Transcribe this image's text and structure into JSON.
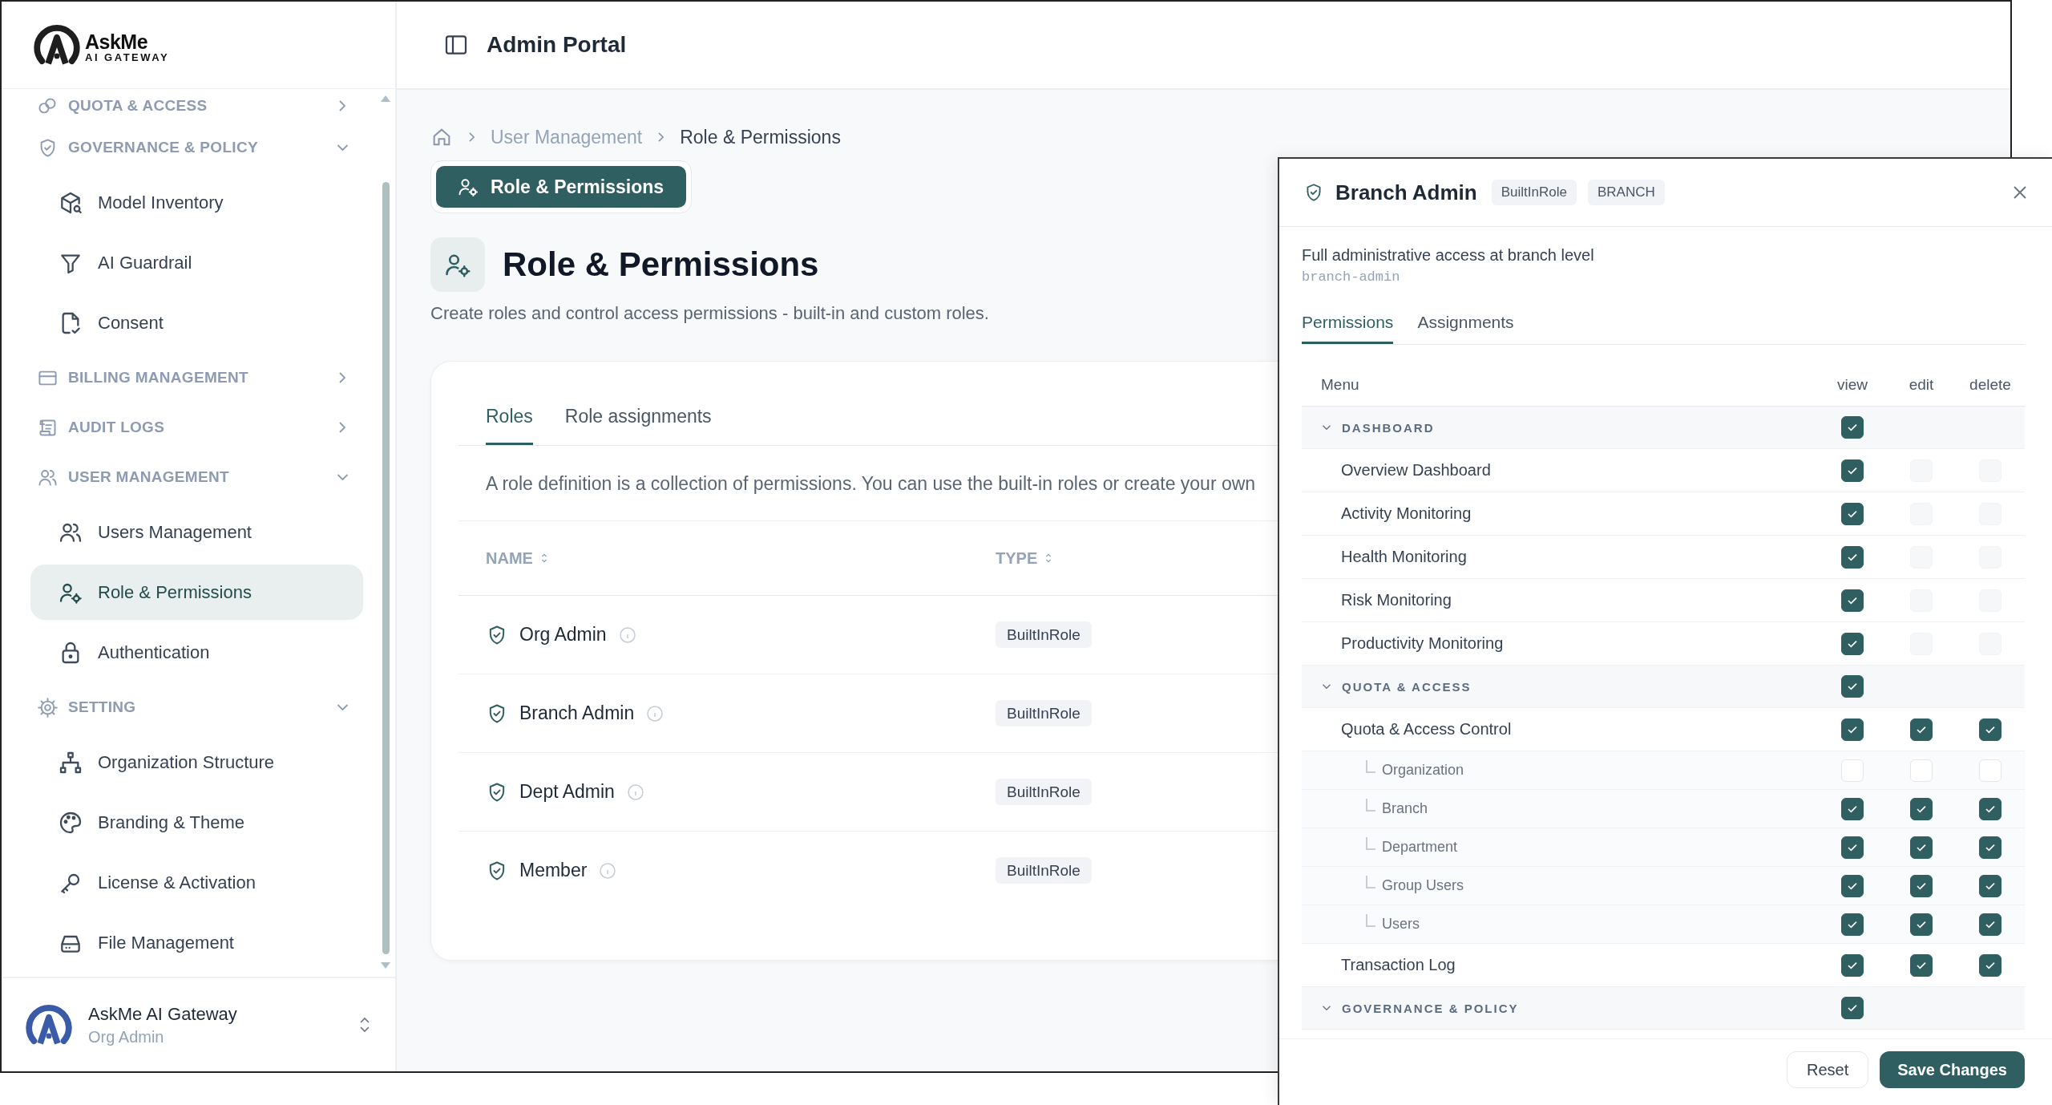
{
  "logo": {
    "name": "AskMe",
    "tagline": "AI GATEWAY"
  },
  "sidebar": {
    "groups": [
      {
        "label": "QUOTA & ACCESS",
        "expanded": false
      },
      {
        "label": "GOVERNANCE & POLICY",
        "expanded": true,
        "items": [
          {
            "label": "Model Inventory",
            "selected": false
          },
          {
            "label": "AI Guardrail",
            "selected": false
          },
          {
            "label": "Consent",
            "selected": false
          }
        ]
      },
      {
        "label": "BILLING MANAGEMENT",
        "expanded": false
      },
      {
        "label": "AUDIT LOGS",
        "expanded": false
      },
      {
        "label": "USER MANAGEMENT",
        "expanded": true,
        "items": [
          {
            "label": "Users Management",
            "selected": false
          },
          {
            "label": "Role & Permissions",
            "selected": true
          },
          {
            "label": "Authentication",
            "selected": false
          }
        ]
      },
      {
        "label": "SETTING",
        "expanded": true,
        "items": [
          {
            "label": "Organization Structure",
            "selected": false
          },
          {
            "label": "Branding & Theme",
            "selected": false
          },
          {
            "label": "License & Activation",
            "selected": false
          },
          {
            "label": "File Management",
            "selected": false
          }
        ]
      }
    ],
    "footer": {
      "name": "AskMe AI Gateway",
      "role": "Org Admin"
    }
  },
  "header": {
    "title": "Admin Portal"
  },
  "breadcrumb": [
    "User Management",
    "Role & Permissions"
  ],
  "page_button": "Role & Permissions",
  "page": {
    "title": "Role & Permissions",
    "subtitle": "Create roles and control access permissions - built-in and custom roles."
  },
  "tabs": [
    {
      "label": "Roles",
      "selected": true
    },
    {
      "label": "Role assignments",
      "selected": false
    }
  ],
  "roles_note": "A role definition is a collection of permissions. You can use the built-in roles or create your own",
  "table": {
    "columns": [
      "NAME",
      "TYPE"
    ],
    "rows": [
      {
        "name": "Org Admin",
        "type": "BuiltInRole"
      },
      {
        "name": "Branch Admin",
        "type": "BuiltInRole"
      },
      {
        "name": "Dept Admin",
        "type": "BuiltInRole"
      },
      {
        "name": "Member",
        "type": "BuiltInRole"
      }
    ]
  },
  "drawer": {
    "title": "Branch Admin",
    "badges": [
      "BuiltInRole",
      "BRANCH"
    ],
    "description": "Full administrative access at branch level",
    "code": "branch-admin",
    "tabs": [
      {
        "label": "Permissions",
        "selected": true
      },
      {
        "label": "Assignments",
        "selected": false
      }
    ],
    "columns": [
      "Menu",
      "view",
      "edit",
      "delete"
    ],
    "permissions": [
      {
        "label": "DASHBOARD",
        "expanded": true,
        "view": {
          "checked": true,
          "disabled": false
        },
        "children": [
          {
            "label": "Overview Dashboard",
            "view": {
              "checked": true,
              "disabled": false
            },
            "edit": {
              "checked": false,
              "disabled": true
            },
            "delete": {
              "checked": false,
              "disabled": true
            }
          },
          {
            "label": "Activity Monitoring",
            "view": {
              "checked": true,
              "disabled": false
            },
            "edit": {
              "checked": false,
              "disabled": true
            },
            "delete": {
              "checked": false,
              "disabled": true
            }
          },
          {
            "label": "Health Monitoring",
            "view": {
              "checked": true,
              "disabled": false
            },
            "edit": {
              "checked": false,
              "disabled": true
            },
            "delete": {
              "checked": false,
              "disabled": true
            }
          },
          {
            "label": "Risk Monitoring",
            "view": {
              "checked": true,
              "disabled": false
            },
            "edit": {
              "checked": false,
              "disabled": true
            },
            "delete": {
              "checked": false,
              "disabled": true
            }
          },
          {
            "label": "Productivity Monitoring",
            "view": {
              "checked": true,
              "disabled": false
            },
            "edit": {
              "checked": false,
              "disabled": true
            },
            "delete": {
              "checked": false,
              "disabled": true
            }
          }
        ]
      },
      {
        "label": "QUOTA & ACCESS",
        "expanded": true,
        "view": {
          "checked": true,
          "disabled": false
        },
        "children": [
          {
            "label": "Quota & Access Control",
            "view": {
              "checked": true,
              "disabled": false
            },
            "edit": {
              "checked": true,
              "disabled": false
            },
            "delete": {
              "checked": true,
              "disabled": false
            },
            "children": [
              {
                "label": "Organization",
                "view": {
                  "checked": false,
                  "disabled": false
                },
                "edit": {
                  "checked": false,
                  "disabled": false
                },
                "delete": {
                  "checked": false,
                  "disabled": false
                }
              },
              {
                "label": "Branch",
                "view": {
                  "checked": true,
                  "disabled": false
                },
                "edit": {
                  "checked": true,
                  "disabled": false
                },
                "delete": {
                  "checked": true,
                  "disabled": false
                }
              },
              {
                "label": "Department",
                "view": {
                  "checked": true,
                  "disabled": false
                },
                "edit": {
                  "checked": true,
                  "disabled": false
                },
                "delete": {
                  "checked": true,
                  "disabled": false
                }
              },
              {
                "label": "Group Users",
                "view": {
                  "checked": true,
                  "disabled": false
                },
                "edit": {
                  "checked": true,
                  "disabled": false
                },
                "delete": {
                  "checked": true,
                  "disabled": false
                }
              },
              {
                "label": "Users",
                "view": {
                  "checked": true,
                  "disabled": false
                },
                "edit": {
                  "checked": true,
                  "disabled": false
                },
                "delete": {
                  "checked": true,
                  "disabled": false
                }
              }
            ]
          },
          {
            "label": "Transaction Log",
            "view": {
              "checked": true,
              "disabled": false
            },
            "edit": {
              "checked": true,
              "disabled": false
            },
            "delete": {
              "checked": true,
              "disabled": false
            }
          }
        ]
      },
      {
        "label": "GOVERNANCE & POLICY",
        "expanded": true,
        "view": {
          "checked": true,
          "disabled": false
        }
      }
    ],
    "buttons": {
      "reset": "Reset",
      "save": "Save Changes"
    }
  }
}
